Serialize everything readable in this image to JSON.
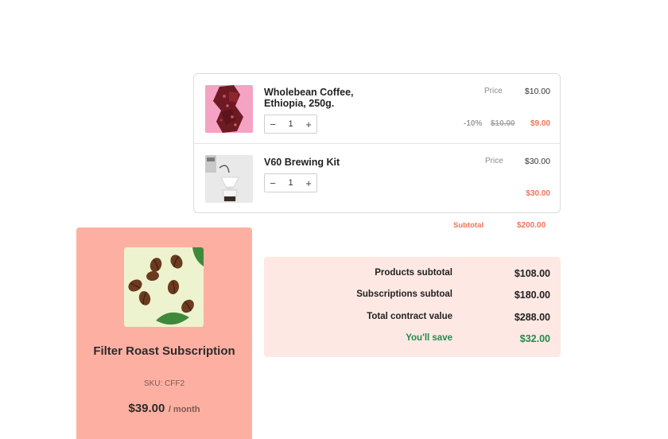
{
  "cart": {
    "items": [
      {
        "name": "Wholebean Coffee, Ethiopia, 250g.",
        "quantity": "1",
        "price_label": "Price",
        "price": "$10.00",
        "discount": "-10%",
        "old_price": "$10.00",
        "final_price": "$9.00",
        "image_icon": "coffee-beans-pink-image"
      },
      {
        "name": "V60 Brewing Kit",
        "quantity": "1",
        "price_label": "Price",
        "price": "$30.00",
        "final_price": "$30.00",
        "image_icon": "brewing-kit-image"
      }
    ],
    "stepper": {
      "minus": "−",
      "plus": "+"
    },
    "subtotal_label": "Subtotal",
    "subtotal_value": "$200.00"
  },
  "subscription": {
    "title": "Filter Roast Subscription",
    "sku": "SKU: CFF2",
    "price": "$39.00",
    "period": "/ month",
    "image_icon": "coffee-beans-image"
  },
  "summary": {
    "rows": [
      {
        "label": "Products subtotal",
        "value": "$108.00"
      },
      {
        "label": "Subscriptions subtoal",
        "value": "$180.00"
      },
      {
        "label": "Total contract value",
        "value": "$288.00"
      },
      {
        "label": "You'll save",
        "value": "$32.00"
      }
    ]
  },
  "colors": {
    "accent": "#f07457",
    "card_bg": "#fdb0a2",
    "summary_bg": "#fde8e4",
    "save_green": "#238a4c"
  }
}
